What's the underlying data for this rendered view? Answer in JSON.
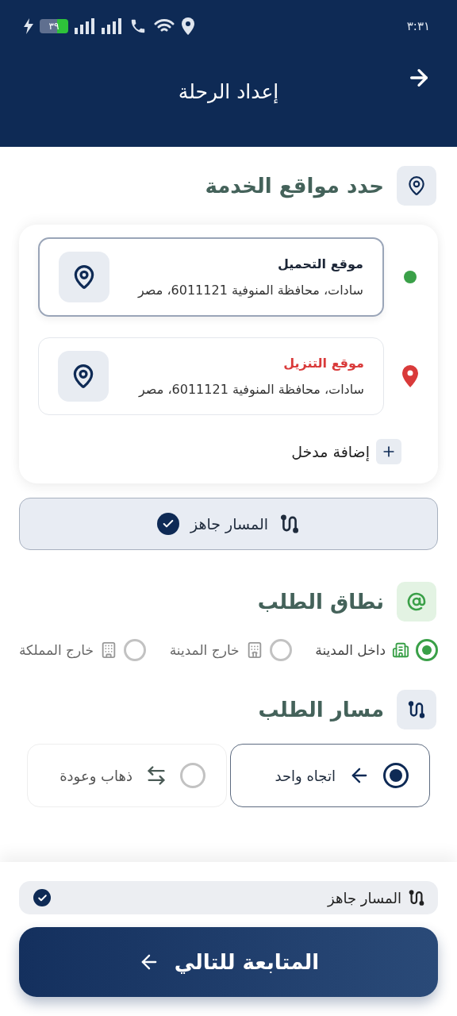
{
  "status_bar": {
    "time": "٣:٣١",
    "battery": "٣٩"
  },
  "header": {
    "title": "إعداد الرحلة"
  },
  "locations": {
    "title": "حدد مواقع الخدمة",
    "add_button": "إضافة مدخل",
    "stops": [
      {
        "kind": "pickup",
        "label": "موقع التحميل",
        "address": "سادات، محافظة المنوفية 6011121، مصر",
        "selected": true
      },
      {
        "kind": "dropoff",
        "label": "موقع التنزيل",
        "address": "سادات، محافظة المنوفية 6011121، مصر",
        "selected": false
      }
    ]
  },
  "route_status": {
    "label": "المسار جاهز",
    "ready": true
  },
  "scope": {
    "title": "نطاق الطلب",
    "options": [
      {
        "kind": "inside_city",
        "label": "داخل المدينة",
        "selected": true
      },
      {
        "kind": "outside_city",
        "label": "خارج المدينة",
        "selected": false
      },
      {
        "kind": "outside_kingdom",
        "label": "خارج المملكة",
        "selected": false
      }
    ]
  },
  "route": {
    "title": "مسار الطلب",
    "options": [
      {
        "kind": "one_way",
        "label": "اتجاه واحد",
        "selected": true
      },
      {
        "kind": "round_trip",
        "label": "ذهاب وعودة",
        "selected": false
      }
    ]
  },
  "footer": {
    "route_status": {
      "label": "المسار جاهز",
      "ready": true
    },
    "continue_button": "المتابعة للتالي"
  }
}
